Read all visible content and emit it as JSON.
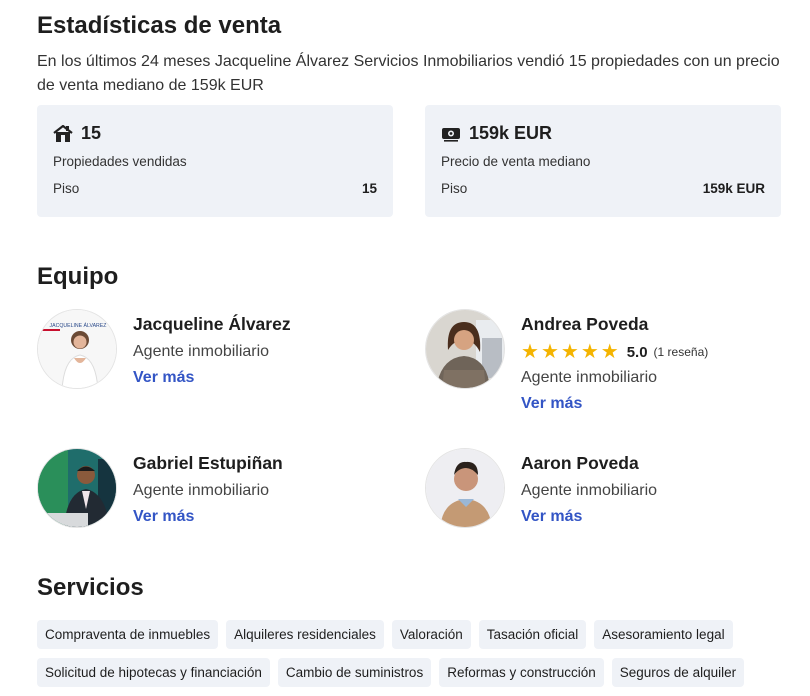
{
  "stats": {
    "title": "Estadísticas de venta",
    "intro": "En los últimos 24 meses Jacqueline Álvarez Servicios Inmobiliarios vendió 15 propiedades con un precio de venta mediano de 159k EUR",
    "cards": [
      {
        "icon": "house-icon",
        "value": "15",
        "label": "Propiedades vendidas",
        "row_label": "Piso",
        "row_value": "15"
      },
      {
        "icon": "money-icon",
        "value": "159k EUR",
        "label": "Precio de venta mediano",
        "row_label": "Piso",
        "row_value": "159k EUR"
      }
    ]
  },
  "team": {
    "title": "Equipo",
    "agents": [
      {
        "name": "Jacqueline Álvarez",
        "role": "Agente inmobiliario",
        "link": "Ver más"
      },
      {
        "name": "Andrea Poveda",
        "role": "Agente inmobiliario",
        "link": "Ver más",
        "rating": {
          "stars": 5,
          "value": "5.0",
          "count": "(1 reseña)"
        }
      },
      {
        "name": "Gabriel Estupiñan",
        "role": "Agente inmobiliario",
        "link": "Ver más"
      },
      {
        "name": "Aaron Poveda",
        "role": "Agente inmobiliario",
        "link": "Ver más"
      }
    ],
    "avatar_logo_text": "JACQUELINE ÁLVAREZ"
  },
  "services": {
    "title": "Servicios",
    "rows": [
      [
        "Compraventa de inmuebles",
        "Alquileres residenciales",
        "Valoración",
        "Tasación oficial",
        "Asesoramiento legal"
      ],
      [
        "Solicitud de hipotecas y financiación",
        "Cambio de suministros",
        "Reformas y construcción",
        "Seguros de alquiler"
      ]
    ]
  },
  "colors": {
    "card_bg": "#eff2f7",
    "link": "#3355c5",
    "star": "#f4b400",
    "text": "#1e1e1e"
  }
}
